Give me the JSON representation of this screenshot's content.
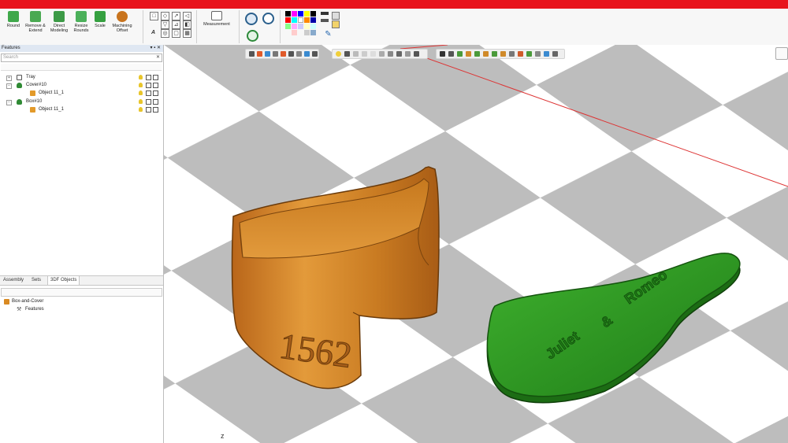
{
  "ribbon": {
    "buttons": [
      {
        "label": "Round",
        "icon": "round-icon"
      },
      {
        "label": "Remove & Extend",
        "icon": "remove-extend-icon"
      },
      {
        "label": "Direct Modeling",
        "icon": "direct-modeling-icon"
      },
      {
        "label": "Resize Rounds",
        "icon": "resize-rounds-icon"
      },
      {
        "label": "Scale",
        "icon": "scale-icon"
      },
      {
        "label": "Machining Offset",
        "icon": "machining-offset-icon"
      }
    ],
    "measurement_label": "Measurement"
  },
  "features_panel": {
    "title": "Features",
    "pin": "▾ ▪ ✕",
    "search_placeholder": "Search",
    "search_clear": "✕",
    "tree": [
      {
        "label": "Tray",
        "level": 0
      },
      {
        "label": "Cover#10",
        "level": 0
      },
      {
        "label": "Object 11_1",
        "level": 1
      },
      {
        "label": "Box#10",
        "level": 0
      },
      {
        "label": "Object 11_1",
        "level": 1
      }
    ]
  },
  "bottom_panel": {
    "tabs": [
      "Assembly",
      "Sets",
      "3DF Objects"
    ],
    "active_tab": "3DF Objects",
    "tree": [
      {
        "label": "Box-and-Cover",
        "level": 0
      },
      {
        "label": "Features",
        "level": 1
      }
    ]
  },
  "viewport": {
    "box_engraving": "1562",
    "cover_engraving_line1": "Romeo",
    "cover_engraving_line2": "&",
    "cover_engraving_line3": "Juliet",
    "axis_label": "z"
  },
  "colors": {
    "title_bar": "#e8141c",
    "box": "#c8761a",
    "cover": "#2f9a22",
    "floor_dark": "#bdbdbd",
    "floor_light": "#ffffff"
  }
}
